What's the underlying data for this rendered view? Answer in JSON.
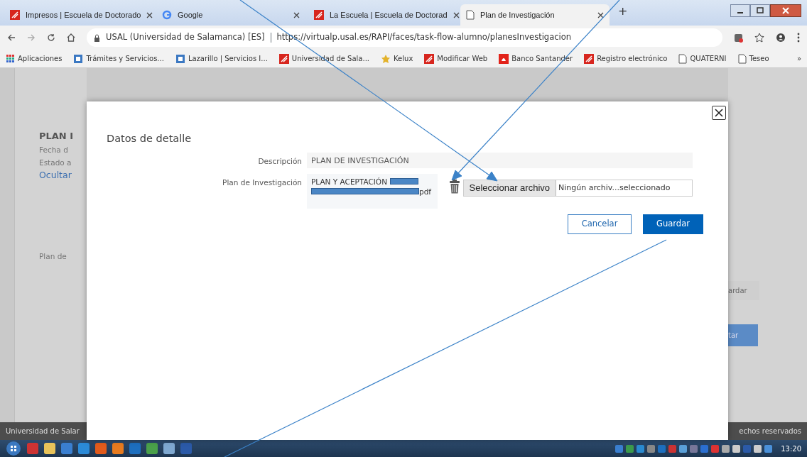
{
  "browser": {
    "tabs": [
      {
        "title": "Impresos | Escuela de Doctorado",
        "selected": false
      },
      {
        "title": "Google",
        "selected": false
      },
      {
        "title": "La Escuela | Escuela de Doctorad",
        "selected": false
      },
      {
        "title": "Plan de Investigación",
        "selected": true
      }
    ],
    "new_tab": "+",
    "address": {
      "site_info": "USAL (Universidad de Salamanca) [ES]",
      "url": "https://virtualp.usal.es/RAPI/faces/task-flow-alumno/planesInvestigacion"
    },
    "bookmarks": [
      {
        "label": "Aplicaciones"
      },
      {
        "label": "Trámites y Servicios..."
      },
      {
        "label": "Lazarillo | Servicios I..."
      },
      {
        "label": "Universidad de Sala..."
      },
      {
        "label": "Kelux"
      },
      {
        "label": "Modificar Web"
      },
      {
        "label": "Banco Santander"
      },
      {
        "label": "Registro electrónico"
      },
      {
        "label": "QUATERNI"
      },
      {
        "label": "Teseo"
      }
    ],
    "overflow": "»"
  },
  "page": {
    "left": {
      "heading": "PLAN I",
      "lines": [
        "Fecha d",
        "Estado a"
      ],
      "link": "Ocultar",
      "section_label": "Plan de"
    },
    "right": {
      "buttons": [
        "ardar",
        "tar"
      ]
    },
    "footer": {
      "left": "Universidad de Salar",
      "right": "echos reservados"
    }
  },
  "dialog": {
    "title": "Datos de detalle",
    "fields": [
      {
        "kind": "text",
        "label": "Descripción",
        "value": "PLAN DE INVESTIGACIÓN"
      },
      {
        "kind": "file",
        "label": "Plan de Investigación",
        "file_name": "PLAN Y ACEPTACIÓN",
        "file_ext": "pdf",
        "choose_button": "Seleccionar archivo",
        "file_status": "Ningún archiv...seleccionado"
      }
    ],
    "buttons": [
      {
        "label": "Cancelar",
        "kind": "secondary"
      },
      {
        "label": "Guardar",
        "kind": "primary"
      }
    ]
  },
  "taskbar": {
    "clock": "13:20"
  }
}
